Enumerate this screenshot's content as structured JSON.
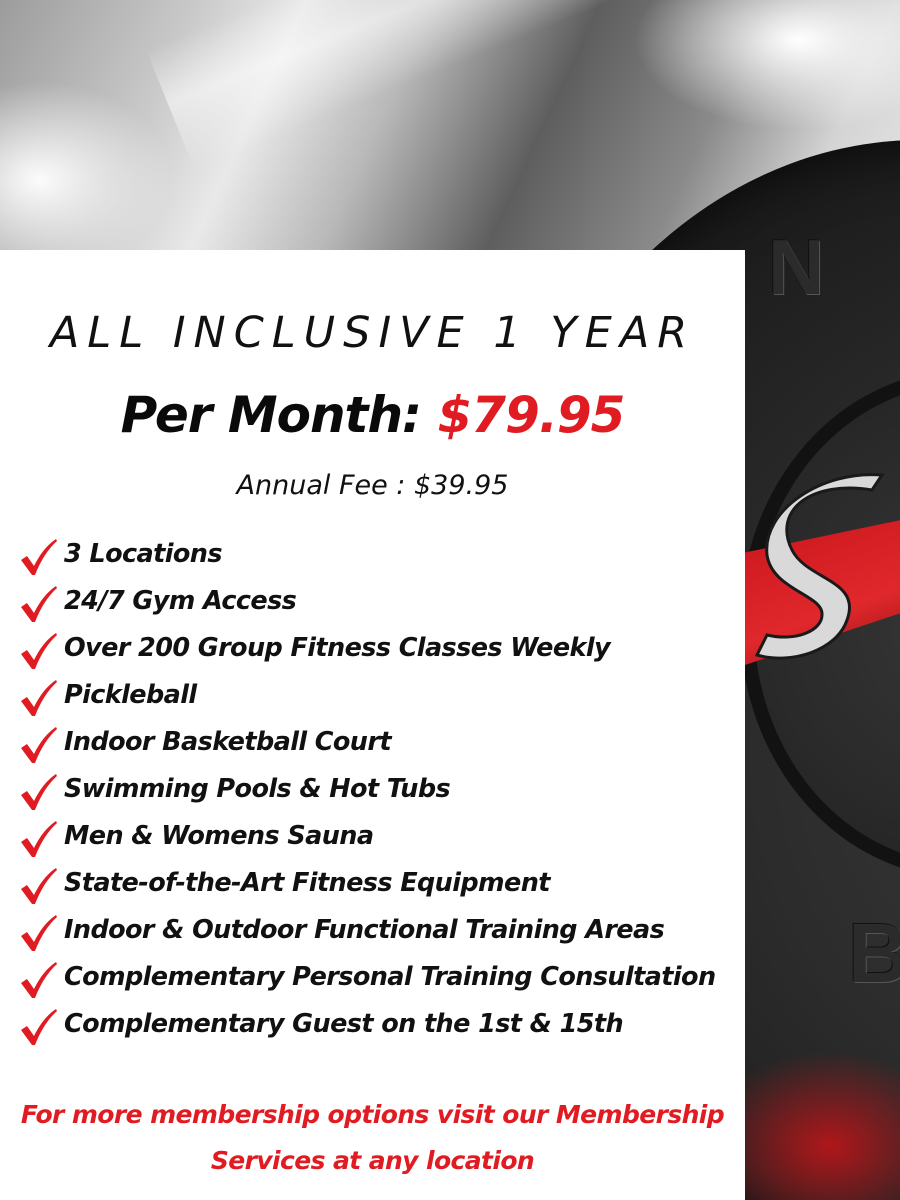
{
  "background": {
    "embossed_letters": [
      "N",
      "B"
    ],
    "accent_color": "#e01b22"
  },
  "plan": {
    "title": "ALL INCLUSIVE 1 YEAR",
    "price_label": "Per Month:",
    "price_value": "$79.95",
    "annual_fee": "Annual Fee : $39.95"
  },
  "features": [
    "3 Locations",
    "24/7 Gym Access",
    "Over 200 Group Fitness Classes Weekly",
    "Pickleball",
    "Indoor Basketball Court",
    "Swimming Pools & Hot Tubs",
    "Men & Womens Sauna",
    "State-of-the-Art Fitness Equipment",
    "Indoor & Outdoor Functional Training Areas",
    "Complementary  Personal Training Consultation",
    "Complementary Guest on the 1st & 15th"
  ],
  "check_icon": "red-checkmark-icon",
  "footer": {
    "line1": "For more membership options visit our Membership",
    "line2": "Services at any location"
  }
}
